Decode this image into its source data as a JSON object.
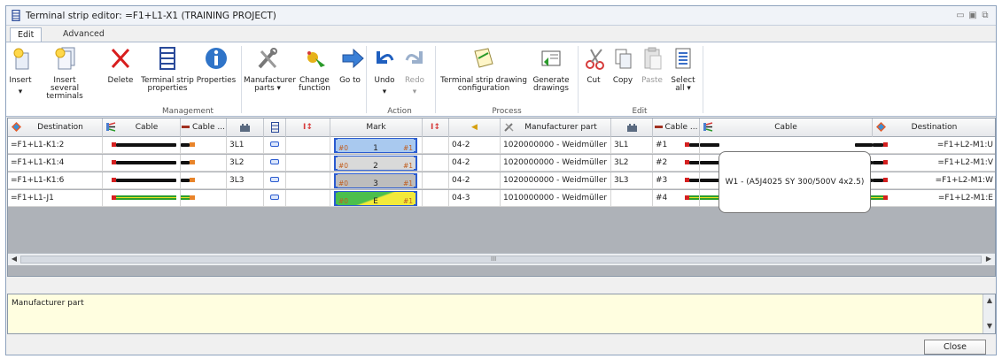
{
  "window": {
    "title": "Terminal strip editor: =F1+L1-X1 (TRAINING PROJECT)"
  },
  "tabs": [
    {
      "label": "Edit"
    },
    {
      "label": "Advanced"
    }
  ],
  "ribbon": {
    "insert": "Insert",
    "insert_several": "Insert several terminals",
    "delete": "Delete",
    "ts_props": "Terminal strip properties",
    "properties": "Properties",
    "manufacturer_parts": "Manufacturer parts ▾",
    "change_function": "Change function",
    "go_to": "Go to",
    "undo": "Undo",
    "redo": "Redo",
    "ts_drawing_config": "Terminal strip drawing configuration",
    "generate_drawings": "Generate drawings",
    "cut": "Cut",
    "copy": "Copy",
    "paste": "Paste",
    "select_all": "Select all ▾",
    "groups": {
      "management": "Management",
      "action": "Action",
      "process": "Process",
      "edit": "Edit"
    }
  },
  "columns": {
    "destination_left": "Destination",
    "cable_left": "Cable",
    "cable_core_left": "Cable ...",
    "mark": "Mark",
    "manufacturer_part": "Manufacturer part",
    "cable_core_right": "Cable ...",
    "cable_right": "Cable",
    "destination_right": "Destination"
  },
  "rows": [
    {
      "dest_left": "=F1+L1-K1:2",
      "conn": "3L1",
      "mark_left": "#0",
      "mark": "1",
      "mark_right": "#1",
      "pos": "04-2",
      "mfr": "1020000000 - Weidmüller",
      "conn2": "3L1",
      "core": "#1",
      "dest_right": "=F1+L2-M1:U"
    },
    {
      "dest_left": "=F1+L1-K1:4",
      "conn": "3L2",
      "mark_left": "#0",
      "mark": "2",
      "mark_right": "#1",
      "pos": "04-2",
      "mfr": "1020000000 - Weidmüller",
      "conn2": "3L2",
      "core": "#2",
      "dest_right": "=F1+L2-M1:V"
    },
    {
      "dest_left": "=F1+L1-K1:6",
      "conn": "3L3",
      "mark_left": "#0",
      "mark": "3",
      "mark_right": "#1",
      "pos": "04-2",
      "mfr": "1020000000 - Weidmüller",
      "conn2": "3L3",
      "core": "#3",
      "dest_right": "=F1+L2-M1:W"
    },
    {
      "dest_left": "=F1+L1-J1",
      "conn": "",
      "mark_left": "#0",
      "mark": "E",
      "mark_right": "#1",
      "pos": "04-3",
      "mfr": "1010000000 - Weidmüller",
      "conn2": "",
      "core": "#4",
      "dest_right": "=F1+L2-M1:E"
    }
  ],
  "cable_label": "W1 - (A5J4025 SY 300/500V 4x2.5)",
  "scroll_mark": "III",
  "description": {
    "text": "Manufacturer part"
  },
  "footer": {
    "close": "Close"
  },
  "colors": {
    "mark_blue": "#a9c9ef",
    "mark_gray": "#bdbdbd",
    "mark_green": "#4cbf4c",
    "mark_yellow": "#f2e93a",
    "accent": "#2a5bd0"
  }
}
